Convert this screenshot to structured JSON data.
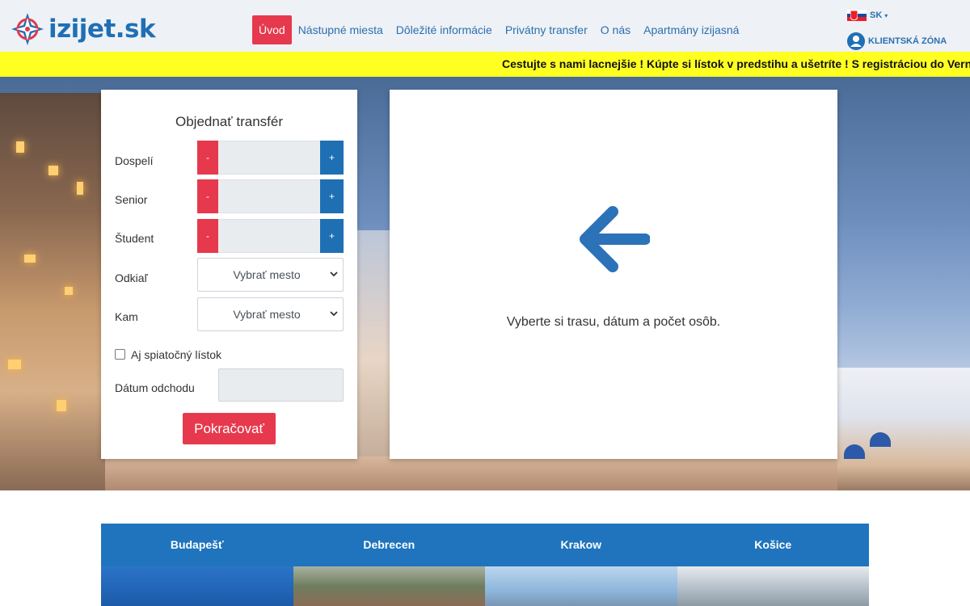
{
  "brand": {
    "logo_main": "izijet",
    "logo_tld": ".sk",
    "accent_red": "#e6394d",
    "accent_blue": "#1f6fb5"
  },
  "nav": {
    "items": [
      {
        "label": "Úvod",
        "active": true
      },
      {
        "label": "Nástupné miesta"
      },
      {
        "label": "Dôležité informácie"
      },
      {
        "label": "Privátny transfer"
      },
      {
        "label": "O nás"
      },
      {
        "label": "Apartmány izijasná"
      }
    ]
  },
  "header": {
    "language": "SK",
    "client_zone": "KLIENTSKÁ ZÓNA"
  },
  "ticker": {
    "text": "Cestujte s nami lacnejšie ! Kúpte si lístok v predstihu a ušetríte ! S registráciou do Vernostného"
  },
  "form": {
    "title": "Objednať transfér",
    "passengers": [
      {
        "label": "Dospelí",
        "minus": "-",
        "plus": "+"
      },
      {
        "label": "Senior",
        "minus": "-",
        "plus": "+"
      },
      {
        "label": "Študent",
        "minus": "-",
        "plus": "+"
      }
    ],
    "from_label": "Odkiaľ",
    "from_value": "Vybrať mesto",
    "to_label": "Kam",
    "to_value": "Vybrať mesto",
    "return_label": "Aj spiatočný lístok",
    "date_label": "Dátum odchodu",
    "continue_label": "Pokračovať"
  },
  "info": {
    "text": "Vyberte si trasu, dátum a počet osôb."
  },
  "destinations": [
    {
      "name": "Budapešť"
    },
    {
      "name": "Debrecen"
    },
    {
      "name": "Krakow"
    },
    {
      "name": "Košice"
    }
  ]
}
